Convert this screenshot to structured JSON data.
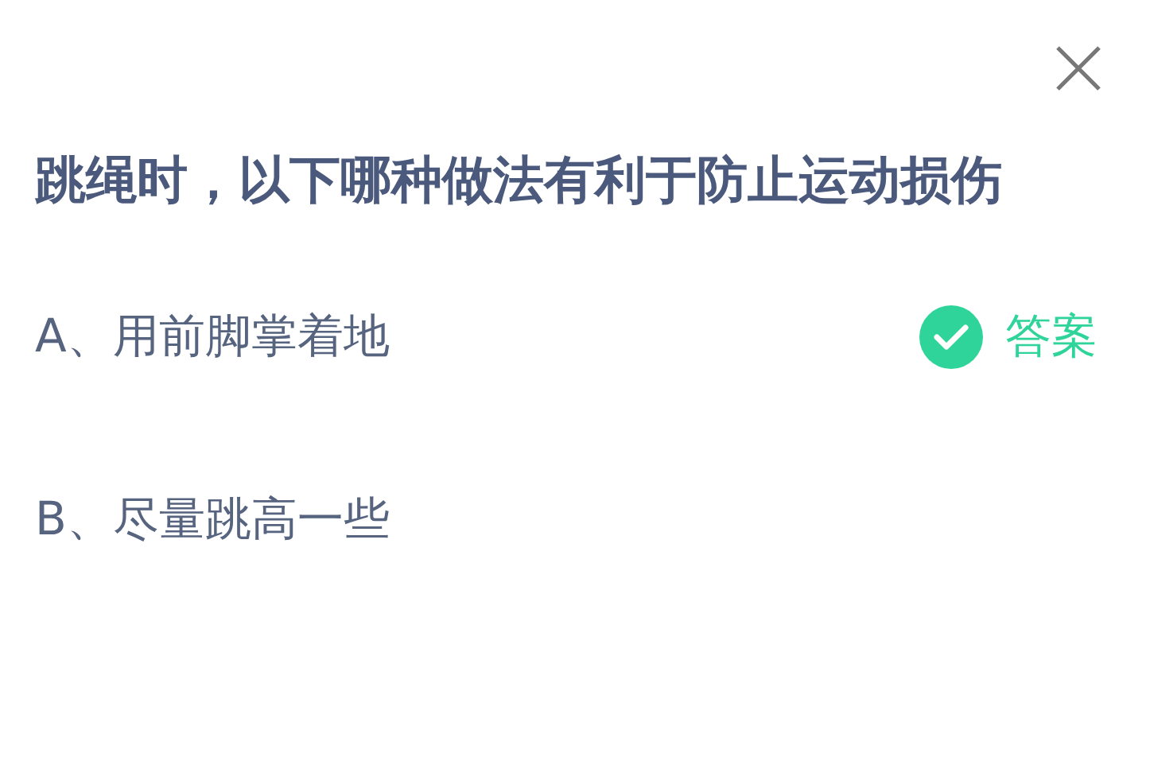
{
  "question": "跳绳时，以下哪种做法有利于防止运动损伤",
  "options": [
    {
      "label": "A、用前脚掌着地",
      "correct": true
    },
    {
      "label": "B、尽量跳高一些",
      "correct": false
    }
  ],
  "answer_label": "答案"
}
